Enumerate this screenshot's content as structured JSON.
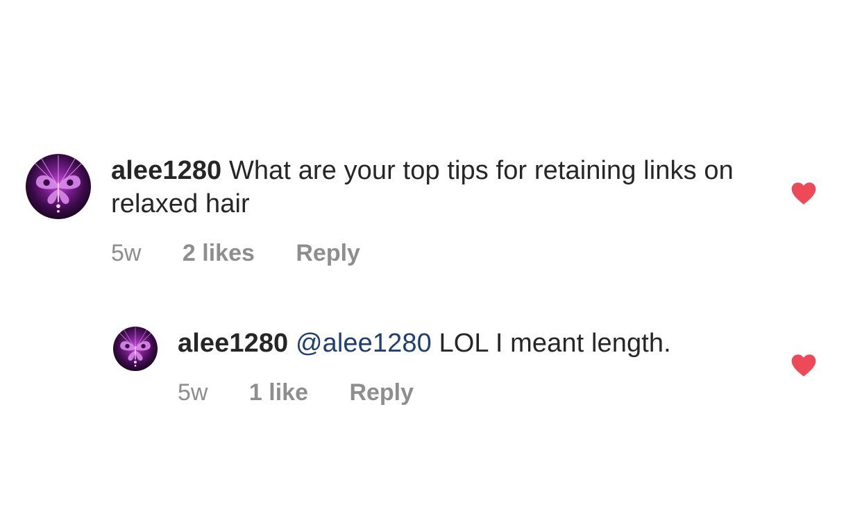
{
  "comments": [
    {
      "username": "alee1280",
      "body": " What are your top tips for retaining links on relaxed hair",
      "time": "5w",
      "likes": "2 likes",
      "reply": "Reply",
      "liked": true,
      "avatar_icon": "butterfly-avatar"
    },
    {
      "username": "alee1280",
      "mention": "@alee1280",
      "body": " LOL I meant length.",
      "time": "5w",
      "likes": "1 like",
      "reply": "Reply",
      "liked": true,
      "avatar_icon": "butterfly-avatar"
    }
  ],
  "colors": {
    "heart": "#ed4956",
    "mention": "#1f3f6e",
    "meta": "#8e8e8e",
    "text": "#262626"
  }
}
